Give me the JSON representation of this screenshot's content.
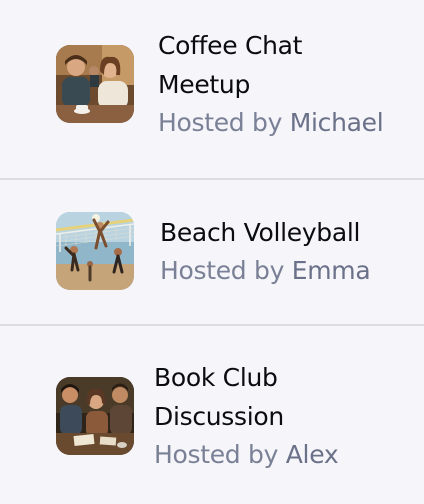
{
  "events": [
    {
      "title_line1": "Coffee Chat",
      "title_line2": "Meetup",
      "hosted_by": "Hosted by",
      "host": "Michael",
      "thumbnail": "coffee-chat-photo"
    },
    {
      "title_line1": "Beach Volleyball",
      "hosted_by": "Hosted by",
      "host": "Emma",
      "thumbnail": "beach-volleyball-photo"
    },
    {
      "title_line1": "Book Club",
      "title_line2": "Discussion",
      "hosted_by": "Hosted by",
      "host": "Alex",
      "thumbnail": "book-club-photo"
    }
  ],
  "colors": {
    "background": "#f5f5fa",
    "divider": "#dcdde3",
    "title": "#0b0b12",
    "subtitle": "#7a8196"
  }
}
